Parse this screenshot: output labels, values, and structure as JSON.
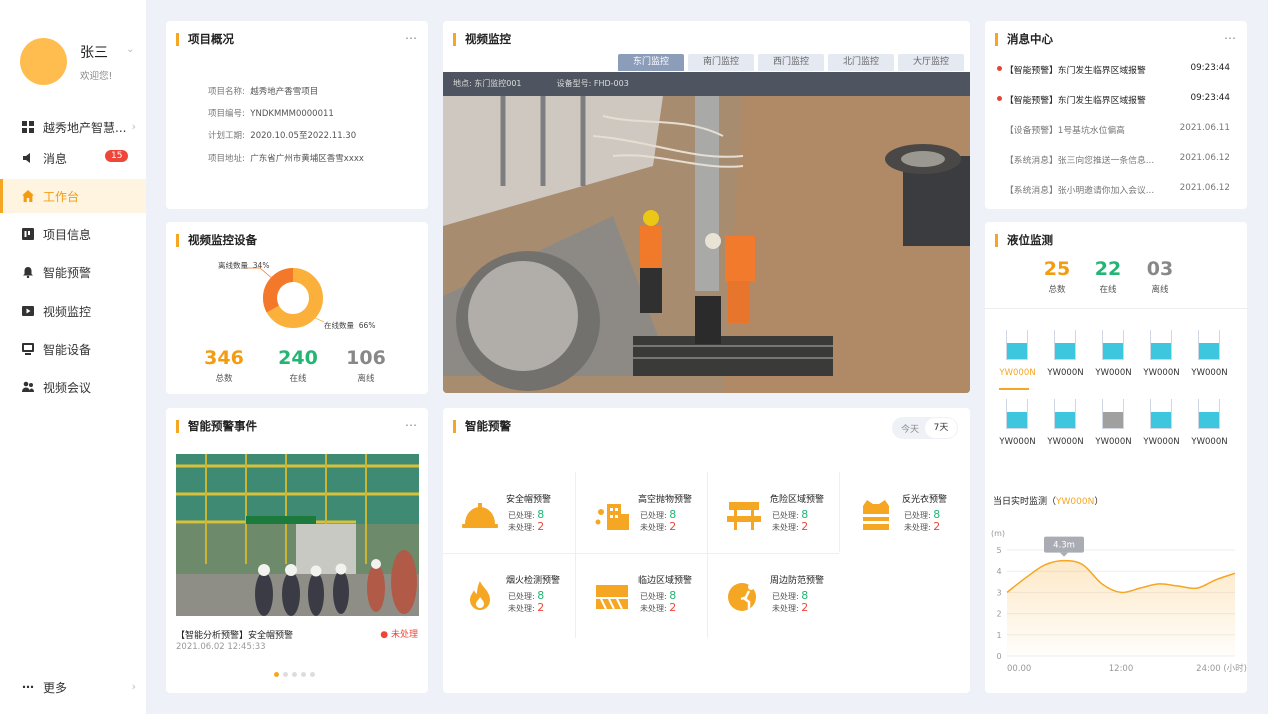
{
  "sidebar": {
    "user_name": "张三",
    "welcome": "欢迎您!",
    "items": [
      {
        "label": "越秀地产智慧..."
      },
      {
        "label": "消息",
        "badge": "15"
      },
      {
        "label": "工作台"
      },
      {
        "label": "项目信息"
      },
      {
        "label": "智能预警"
      },
      {
        "label": "视频监控"
      },
      {
        "label": "智能设备"
      },
      {
        "label": "视频会议"
      }
    ],
    "more": "更多"
  },
  "project": {
    "title": "项目概况",
    "rows": [
      {
        "label": "项目名称:",
        "value": "越秀地产香雪项目"
      },
      {
        "label": "项目编号:",
        "value": "YNDKMMM0000011"
      },
      {
        "label": "计划工期:",
        "value": "2020.10.05至2022.11.30"
      },
      {
        "label": "项目地址:",
        "value": "广东省广州市黄埔区香雪xxxx"
      }
    ]
  },
  "devices": {
    "title": "视频监控设备",
    "offline_label": "离线数量",
    "offline_pct": "34%",
    "online_label": "在线数量",
    "online_pct": "66%",
    "stats": [
      {
        "num": "346",
        "label": "总数",
        "color": "#f39c12"
      },
      {
        "num": "240",
        "label": "在线",
        "color": "#22b573"
      },
      {
        "num": "106",
        "label": "离线",
        "color": "#888888"
      }
    ]
  },
  "events": {
    "title": "智能预警事件",
    "caption": "【智能分析预警】安全帽预警",
    "status": "未处理",
    "time": "2021.06.02 12:45:33"
  },
  "video": {
    "title": "视频监控",
    "tabs": [
      "东门监控",
      "南门监控",
      "西门监控",
      "北门监控",
      "大厅监控"
    ],
    "location_label": "地点:",
    "location": "东门监控001",
    "model_label": "设备型号:",
    "model": "FHD-003"
  },
  "alarms": {
    "title": "智能预警",
    "toggle_today": "今天",
    "toggle_7d": "7天",
    "done_label": "已处理:",
    "todo_label": "未处理:",
    "items": [
      {
        "name": "安全帽预警",
        "done": "8",
        "todo": "2"
      },
      {
        "name": "高空抛物预警",
        "done": "8",
        "todo": "2"
      },
      {
        "name": "危险区域预警",
        "done": "8",
        "todo": "2"
      },
      {
        "name": "反光衣预警",
        "done": "8",
        "todo": "2"
      },
      {
        "name": "烟火检测预警",
        "done": "8",
        "todo": "2"
      },
      {
        "name": "临边区域预警",
        "done": "8",
        "todo": "2"
      },
      {
        "name": "周边防范预警",
        "done": "8",
        "todo": "2"
      }
    ]
  },
  "messages": {
    "title": "消息中心",
    "items": [
      {
        "text": "【智能预警】东门发生临界区域报警",
        "date": "09:23:44",
        "unread": true
      },
      {
        "text": "【智能预警】东门发生临界区域报警",
        "date": "09:23:44",
        "unread": true
      },
      {
        "text": "【设备预警】1号基坑水位偏高",
        "date": "2021.06.11",
        "unread": false
      },
      {
        "text": "【系统消息】张三向您推送一条信息...",
        "date": "2021.06.12",
        "unread": false
      },
      {
        "text": "【系统消息】张小明邀请你加入会议...",
        "date": "2021.06.12",
        "unread": false
      }
    ]
  },
  "liquid": {
    "title": "液位监测",
    "stats": [
      {
        "num": "25",
        "label": "总数",
        "color": "#f39c12"
      },
      {
        "num": "22",
        "label": "在线",
        "color": "#22b573"
      },
      {
        "num": "03",
        "label": "离线",
        "color": "#888888"
      }
    ],
    "tanks": [
      {
        "label": "YW000N",
        "level": 0.55,
        "color": "#3fc6df"
      },
      {
        "label": "YW000N",
        "level": 0.55,
        "color": "#3fc6df"
      },
      {
        "label": "YW000N",
        "level": 0.55,
        "color": "#3fc6df"
      },
      {
        "label": "YW000N",
        "level": 0.55,
        "color": "#3fc6df"
      },
      {
        "label": "YW000N",
        "level": 0.55,
        "color": "#3fc6df"
      },
      {
        "label": "YW000N",
        "level": 0.55,
        "color": "#3fc6df"
      },
      {
        "label": "YW000N",
        "level": 0.55,
        "color": "#3fc6df"
      },
      {
        "label": "YW000N",
        "level": 0.55,
        "color": "#a0a0a0"
      },
      {
        "label": "YW000N",
        "level": 0.55,
        "color": "#3fc6df"
      },
      {
        "label": "YW000N",
        "level": 0.55,
        "color": "#3fc6df"
      }
    ],
    "realtime_label": "当日实时监测（",
    "realtime_device": "YW000N",
    "realtime_close": "）"
  },
  "chart_data": {
    "type": "area",
    "ylabel": "(m)",
    "xlabel": "",
    "x_ticks": [
      "00.00",
      "12:00",
      "24:00 (小时)"
    ],
    "y_ticks": [
      "0",
      "1",
      "2",
      "3",
      "4",
      "5"
    ],
    "ylim": [
      0,
      5
    ],
    "tooltip": "4.3m",
    "color": "#f5a623",
    "series": [
      {
        "x": [
          0,
          2,
          4,
          6,
          8,
          10,
          12,
          14,
          16,
          18,
          20,
          22,
          24
        ],
        "values": [
          3.0,
          3.7,
          4.3,
          4.5,
          4.3,
          3.4,
          3.0,
          3.2,
          3.4,
          3.3,
          3.2,
          3.6,
          3.9
        ]
      }
    ]
  }
}
